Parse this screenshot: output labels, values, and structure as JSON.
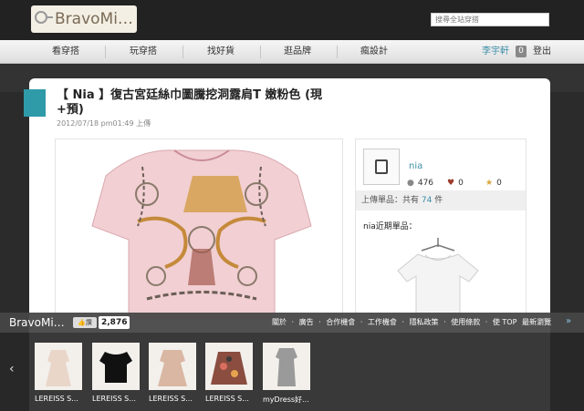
{
  "header": {
    "logo_text": "BravoMi…",
    "search_placeholder": "搜尋全站穿搭"
  },
  "nav": {
    "items": [
      "看穿搭",
      "玩穿搭",
      "找好貨",
      "逛品牌",
      "瘋設計"
    ],
    "user_name": "李宇軒",
    "badge_count": "0",
    "logout_label": "登出"
  },
  "product": {
    "title": "【 Nia 】復古宮廷絲巾圖騰挖洞露肩T 嫩粉色 (現+預)",
    "date": "2012/07/18 pm01:49 上傳"
  },
  "seller": {
    "name": "nia",
    "views": "476",
    "likes": "0",
    "stars": "0",
    "uploaded_label": "上傳單品：共有",
    "uploaded_count": "74",
    "uploaded_unit": "件",
    "recent_label": "nia近期單品："
  },
  "bottombar": {
    "logo_text": "BravoMi…",
    "like_label": "讚",
    "like_count": "2,876",
    "links": [
      "關於",
      "·",
      "廣告",
      "·",
      "合作機會",
      "·",
      "工作機會",
      "·",
      "隱私政策",
      "·",
      "使用條款",
      "·",
      "使 TOP",
      "最新瀏覽"
    ]
  },
  "strip": {
    "items": [
      {
        "label": "LEREISS S...",
        "color": "#e9d6c9"
      },
      {
        "label": "LEREISS S...",
        "color": "#111111"
      },
      {
        "label": "LEREISS S...",
        "color": "#d9b7a3"
      },
      {
        "label": "LEREISS S...",
        "color": "#8a4d3f"
      },
      {
        "label": "myDress好...",
        "color": "#9a9a9a"
      }
    ]
  },
  "colors": {
    "accent": "#2f9aa8",
    "link": "#3b8ea8"
  }
}
